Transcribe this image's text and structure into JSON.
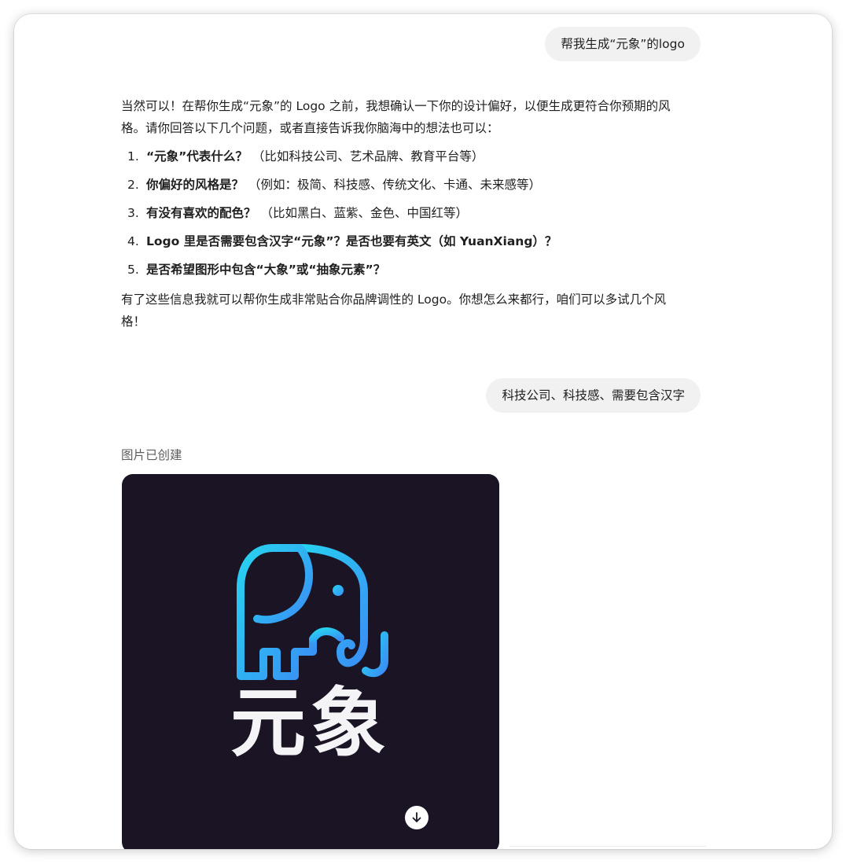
{
  "messages": {
    "user_1": "帮我生成“元象”的logo",
    "assistant_intro": "当然可以！在帮你生成“元象”的 Logo 之前，我想确认一下你的设计偏好，以便生成更符合你预期的风格。请你回答以下几个问题，或者直接告诉我你脑海中的想法也可以：",
    "questions": [
      {
        "num": "1.",
        "bold": "“元象”代表什么？",
        "note": "（比如科技公司、艺术品牌、教育平台等）"
      },
      {
        "num": "2.",
        "bold": "你偏好的风格是？",
        "note": "（例如：极简、科技感、传统文化、卡通、未来感等）"
      },
      {
        "num": "3.",
        "bold": "有没有喜欢的配色？",
        "note": "（比如黑白、蓝紫、金色、中国红等）"
      },
      {
        "num": "4.",
        "bold": "Logo 里是否需要包含汉字“元象”？是否也要有英文（如 YuanXiang）？",
        "note": ""
      },
      {
        "num": "5.",
        "bold": "是否希望图形中包含“大象”或“抽象元素”？",
        "note": ""
      }
    ],
    "assistant_outro": "有了这些信息我就可以帮你生成非常贴合你品牌调性的 Logo。你想怎么来都行，咱们可以多试几个风格！",
    "user_2": "科技公司、科技感、需要包含汉字",
    "image_caption": "图片已创建"
  },
  "generated_image": {
    "logo_text": "元象",
    "background_color": "#1a1424",
    "gradient_start": "#27d3f0",
    "gradient_end": "#3a8ef5",
    "icon": "elephant-icon"
  },
  "controls": {
    "download_icon": "download-icon"
  }
}
